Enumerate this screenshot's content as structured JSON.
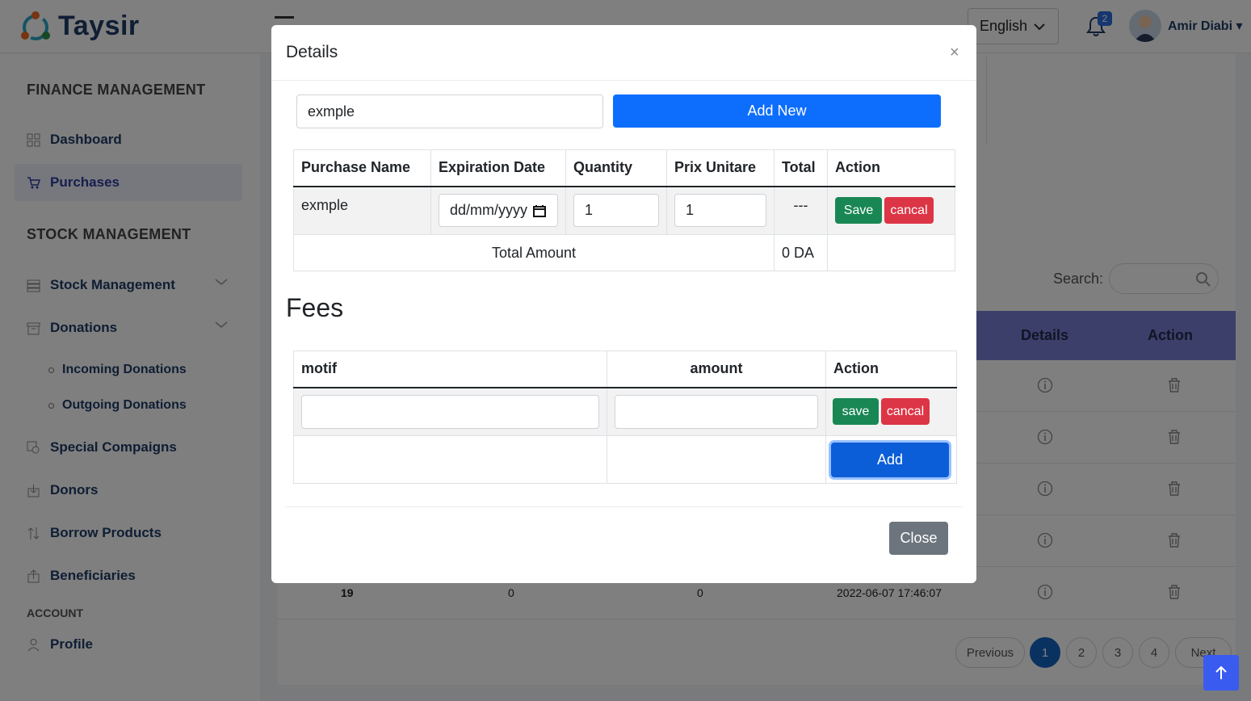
{
  "app": {
    "brand": "Taysir",
    "language": "English",
    "notifications_count": "2",
    "user_name": "Amir Diabi"
  },
  "sidebar": {
    "finance_title": "FINANCE MANAGEMENT",
    "stock_title": "STOCK MANAGEMENT",
    "account_title": "ACCOUNT",
    "items": {
      "dashboard": "Dashboard",
      "purchases": "Purchases",
      "stock_management": "Stock Management",
      "donations": "Donations",
      "incoming_donations": "Incoming Donations",
      "outgoing_donations": "Outgoing Donations",
      "special_compaigns": "Special Compaigns",
      "donors": "Donors",
      "borrow_products": "Borrow Products",
      "beneficiaries": "Beneficiaries",
      "profile": "Profile"
    }
  },
  "list": {
    "search_label": "Search:",
    "col_details": "Details",
    "col_action": "Action",
    "last_row": {
      "id": "19",
      "a": "0",
      "b": "0",
      "date": "2022-06-07 17:46:07"
    },
    "pagination": {
      "previous": "Previous",
      "pages": [
        "1",
        "2",
        "3",
        "4"
      ],
      "active_page": "1",
      "next": "Next"
    }
  },
  "modal": {
    "title": "Details",
    "close_x": "×",
    "name_input_value": "exmple",
    "add_new_label": "Add New",
    "purchase_table": {
      "headers": [
        "Purchase Name",
        "Expiration Date",
        "Quantity",
        "Prix Unitare",
        "Total",
        "Action"
      ],
      "row": {
        "purchase_name": "exmple",
        "expiration_placeholder": "dd/mm/yyyy",
        "quantity": "1",
        "prix_unitare": "1",
        "total": "---",
        "save_label": "Save",
        "cancel_label": "cancal"
      },
      "total_amount_label": "Total Amount",
      "total_amount_value": "0 DA"
    },
    "fees": {
      "heading": "Fees",
      "headers": [
        "motif",
        "amount",
        "Action"
      ],
      "row": {
        "motif_value": "",
        "amount_value": "",
        "save_label": "save",
        "cancel_label": "cancal"
      },
      "add_label": "Add"
    },
    "close_label": "Close"
  }
}
